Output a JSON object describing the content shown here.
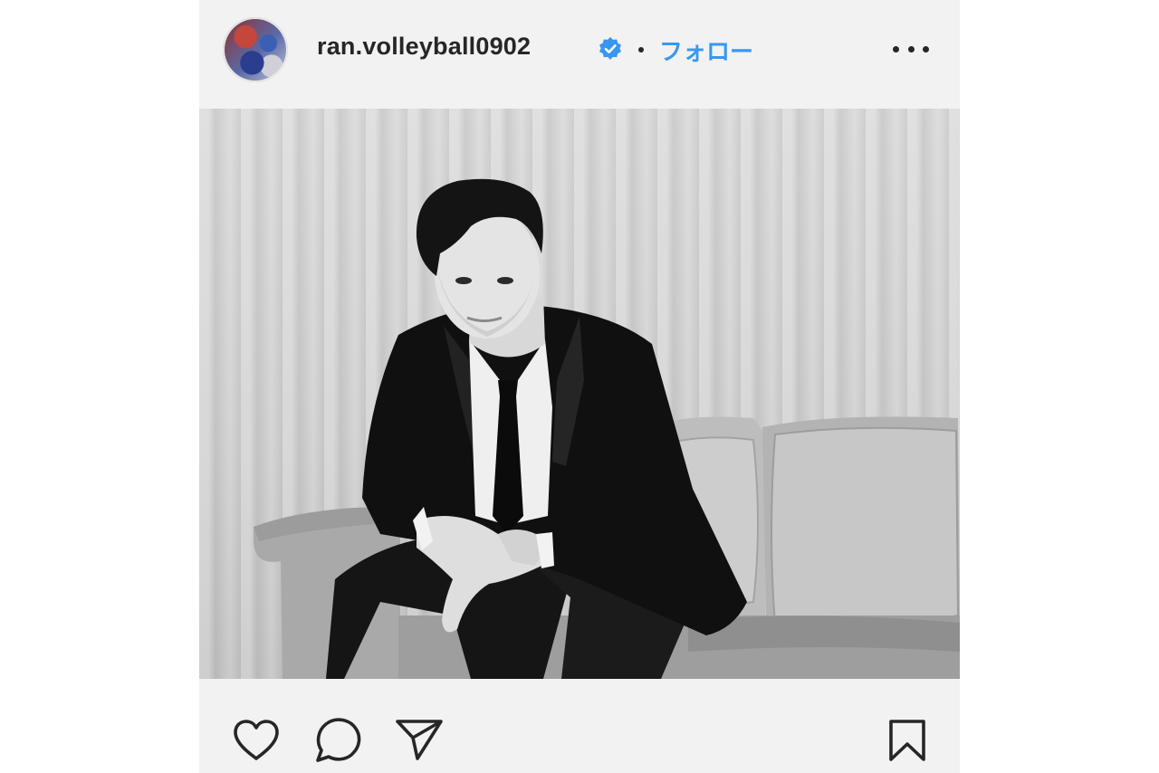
{
  "post": {
    "username": "ran.volleyball0902",
    "verified": true,
    "separator": "•",
    "follow_label": "フォロー",
    "more_icon": "more-horizontal-icon"
  },
  "photo": {
    "style": "black-and-white",
    "subject": "man-in-suit-on-sofa"
  },
  "actions": {
    "like_icon": "heart-icon",
    "comment_icon": "comment-icon",
    "share_icon": "send-icon",
    "save_icon": "bookmark-icon"
  },
  "colors": {
    "accent": "#3897f0",
    "text": "#262626",
    "background": "#f2f2f2"
  }
}
